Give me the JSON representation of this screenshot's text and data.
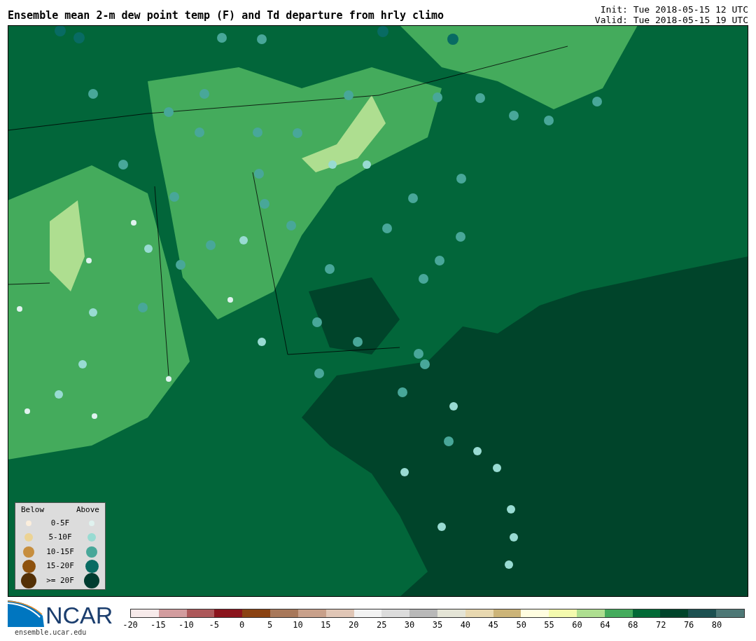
{
  "title": "Ensemble mean 2-m dew point temp (F) and Td departure from hrly climo",
  "init": "Init: Tue 2018-05-15 12 UTC",
  "valid": "Valid: Tue 2018-05-15 19 UTC",
  "legend": {
    "below_heading": "Below",
    "above_heading": "Above",
    "rows": [
      {
        "label": "0-5F",
        "below": {
          "color": "#fbeedc"
        },
        "above": {
          "color": "#e0f2ef"
        }
      },
      {
        "label": "5-10F",
        "below": {
          "color": "#ecd394"
        },
        "above": {
          "color": "#98dbd2"
        }
      },
      {
        "label": "10-15F",
        "below": {
          "color": "#c68e3e"
        },
        "above": {
          "color": "#48a799"
        }
      },
      {
        "label": "15-20F",
        "below": {
          "color": "#8e520e"
        },
        "above": {
          "color": "#086b63"
        }
      },
      {
        "label": ">= 20F",
        "below": {
          "color": "#543005"
        },
        "above": {
          "color": "#003c30"
        }
      }
    ]
  },
  "logo": {
    "name": "NCAR",
    "url": "ensemble.ucar.edu"
  },
  "colorbar": [
    {
      "label": "-20",
      "color": "#f7eaea"
    },
    {
      "label": "-15",
      "color": "#d29c9e"
    },
    {
      "label": "-10",
      "color": "#ad585a"
    },
    {
      "label": "-5",
      "color": "#8b141c"
    },
    {
      "label": "0",
      "color": "#8a4212"
    },
    {
      "label": "5",
      "color": "#a8785a"
    },
    {
      "label": "10",
      "color": "#c8a08a"
    },
    {
      "label": "15",
      "color": "#e0c6b6"
    },
    {
      "label": "20",
      "color": "#f2f2f2"
    },
    {
      "label": "25",
      "color": "#dcdcdc"
    },
    {
      "label": "30",
      "color": "#b8b8b8"
    },
    {
      "label": "35",
      "color": "#e4e4d6"
    },
    {
      "label": "40",
      "color": "#e8d8b0"
    },
    {
      "label": "45",
      "color": "#ccb478"
    },
    {
      "label": "50",
      "color": "#fffde0"
    },
    {
      "label": "55",
      "color": "#f4faae"
    },
    {
      "label": "60",
      "color": "#aede90"
    },
    {
      "label": "64",
      "color": "#44ab5c"
    },
    {
      "label": "68",
      "color": "#026a36"
    },
    {
      "label": "72",
      "color": "#00442a"
    },
    {
      "label": "76",
      "color": "#1c5050"
    },
    {
      "label": "80",
      "color": "#4e7876"
    }
  ]
}
